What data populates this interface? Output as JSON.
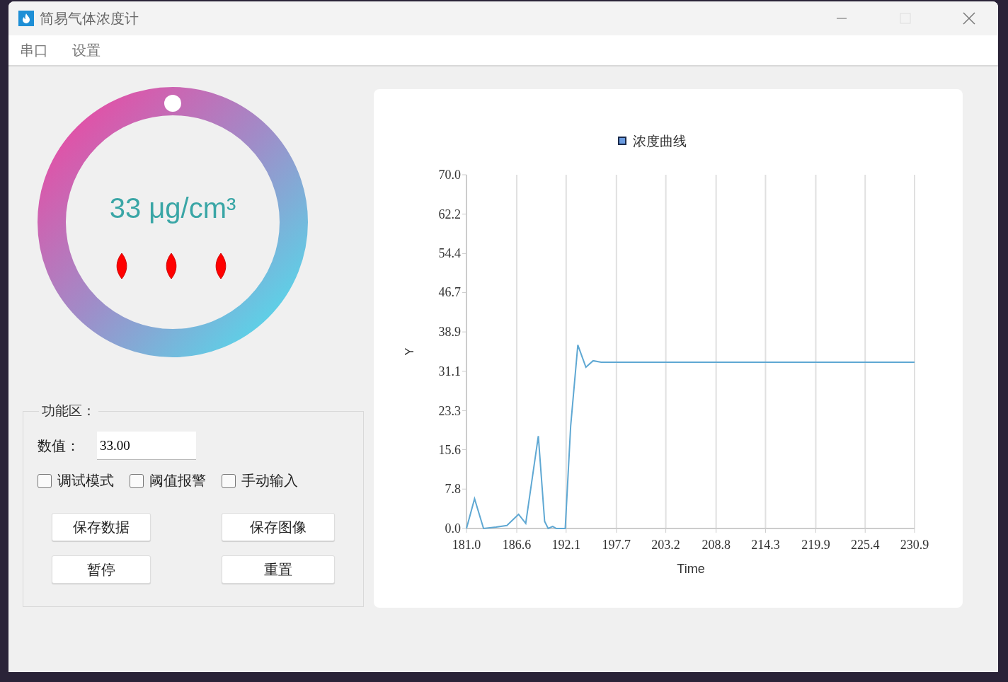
{
  "window": {
    "title": "简易气体浓度计"
  },
  "menu": [
    {
      "label": "串口"
    },
    {
      "label": "设置"
    }
  ],
  "gauge": {
    "reading": "33 μg/cm³"
  },
  "function_area": {
    "title": "功能区：",
    "value_label": "数值：",
    "value": "33.00",
    "options": [
      {
        "label": "调试模式",
        "checked": false
      },
      {
        "label": "阈值报警",
        "checked": false
      },
      {
        "label": "手动输入",
        "checked": false
      }
    ],
    "buttons": [
      "保存数据",
      "保存图像",
      "暂停",
      "重置"
    ]
  },
  "chart": {
    "chart_data": {
      "type": "line",
      "grid": true,
      "xlabel": "Time",
      "ylabel": "Y",
      "x": [
        181.0,
        181.9,
        182.9,
        184.3,
        185.5,
        186.8,
        187.6,
        189.0,
        189.7,
        190.1,
        190.6,
        191.0,
        192.0,
        192.6,
        193.4,
        194.3,
        195.1,
        196.0,
        230.9
      ],
      "series": [
        {
          "name": "浓度曲线",
          "color": "#5fa8d3",
          "values": [
            0,
            5.9,
            0,
            0.3,
            0.6,
            2.8,
            1.0,
            18.3,
            1.4,
            0,
            0.4,
            0,
            0,
            20.3,
            36.3,
            31.9,
            33.2,
            32.9,
            32.9
          ]
        }
      ],
      "xlim": [
        181.0,
        230.9
      ],
      "ylim": [
        0,
        70
      ],
      "xticks": [
        {
          "value": 181.0,
          "label": "181.0"
        },
        {
          "value": 186.6,
          "label": "186.6"
        },
        {
          "value": 192.1,
          "label": "192.1"
        },
        {
          "value": 197.7,
          "label": "197.7"
        },
        {
          "value": 203.2,
          "label": "203.2"
        },
        {
          "value": 208.8,
          "label": "208.8"
        },
        {
          "value": 214.3,
          "label": "214.3"
        },
        {
          "value": 219.9,
          "label": "219.9"
        },
        {
          "value": 225.4,
          "label": "225.4"
        },
        {
          "value": 230.9,
          "label": "230.9"
        }
      ],
      "yticks": [
        {
          "value": 0,
          "label": "0.0"
        },
        {
          "value": 7.8,
          "label": "7.8"
        },
        {
          "value": 15.6,
          "label": "15.6"
        },
        {
          "value": 23.3,
          "label": "23.3"
        },
        {
          "value": 31.1,
          "label": "31.1"
        },
        {
          "value": 38.9,
          "label": "38.9"
        },
        {
          "value": 46.7,
          "label": "46.7"
        },
        {
          "value": 54.4,
          "label": "54.4"
        },
        {
          "value": 62.2,
          "label": "62.2"
        },
        {
          "value": 70,
          "label": "70.0"
        }
      ]
    }
  }
}
